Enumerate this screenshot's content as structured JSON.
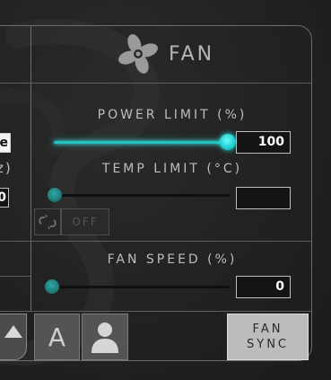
{
  "left_panel": {
    "mode_value_fragment": "e",
    "freq_label_fragment": "z)",
    "freq_value_fragment": "0"
  },
  "fan_panel": {
    "title": "FAN",
    "header_icon": "fan-icon",
    "power_limit": {
      "label": "POWER LIMIT (%)",
      "value": "100",
      "slider_percent": 100
    },
    "temp_limit": {
      "label": "TEMP LIMIT (°C)",
      "value": "",
      "slider_percent": 0
    },
    "link_icon": "link-broken-icon",
    "link_toggle_label": "OFF",
    "fan_speed": {
      "label": "FAN SPEED (%)",
      "value": "0",
      "slider_percent": 0
    },
    "buttons": {
      "auto_label": "A",
      "user_icon": "user-icon",
      "fan_sync_line1": "FAN",
      "fan_sync_line2": "SYNC"
    }
  },
  "colors": {
    "accent": "#22c2c2",
    "panel_border": "#6c6c6c",
    "label_text": "#bdbdbd",
    "button_bg": "#545454",
    "sync_bg": "#bcbcbc"
  }
}
